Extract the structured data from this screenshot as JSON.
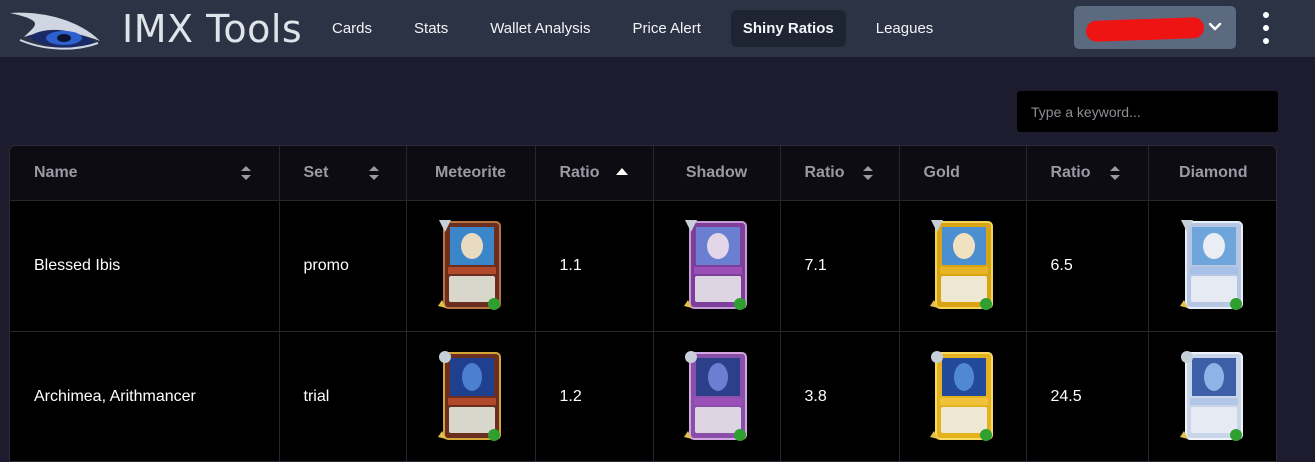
{
  "brand": {
    "title": "IMX Tools",
    "logo_icon": "eye-logo-icon"
  },
  "nav": {
    "items": [
      {
        "label": "Cards",
        "active": false
      },
      {
        "label": "Stats",
        "active": false
      },
      {
        "label": "Wallet Analysis",
        "active": false
      },
      {
        "label": "Price Alert",
        "active": false
      },
      {
        "label": "Shiny Ratios",
        "active": true
      },
      {
        "label": "Leagues",
        "active": false
      }
    ]
  },
  "user_menu": {
    "icon": "chevron-down-icon",
    "note": "redacted"
  },
  "more_menu_icon": "kebab-menu-icon",
  "search": {
    "placeholder": "Type a keyword...",
    "value": ""
  },
  "table": {
    "columns": [
      {
        "label": "Name",
        "sort": "both"
      },
      {
        "label": "Set",
        "sort": "both"
      },
      {
        "label": "Meteorite",
        "sort": "none"
      },
      {
        "label": "Ratio",
        "sort": "asc"
      },
      {
        "label": "Shadow",
        "sort": "none"
      },
      {
        "label": "Ratio",
        "sort": "both"
      },
      {
        "label": "Gold",
        "sort": "none"
      },
      {
        "label": "Ratio",
        "sort": "both"
      },
      {
        "label": "Diamond",
        "sort": "none"
      }
    ],
    "rows": [
      {
        "name": "Blessed Ibis",
        "set": "promo",
        "meteorite_ratio": "1.1",
        "shadow_ratio": "7.1",
        "gold_ratio": "6.5",
        "card_art": "ibis"
      },
      {
        "name": "Archimea, Arithmancer",
        "set": "trial",
        "meteorite_ratio": "1.2",
        "shadow_ratio": "3.8",
        "gold_ratio": "24.5",
        "card_art": "archimea"
      }
    ]
  },
  "colors": {
    "navbar": "#2c3344",
    "page_bg": "#1d1c2e",
    "table_bg": "#000000",
    "meteorite": "#7a3a2a",
    "shadow": "#8a4fa8",
    "gold": "#e3b21c",
    "diamond": "#c9d6ea",
    "redaction": "#ee1414"
  }
}
